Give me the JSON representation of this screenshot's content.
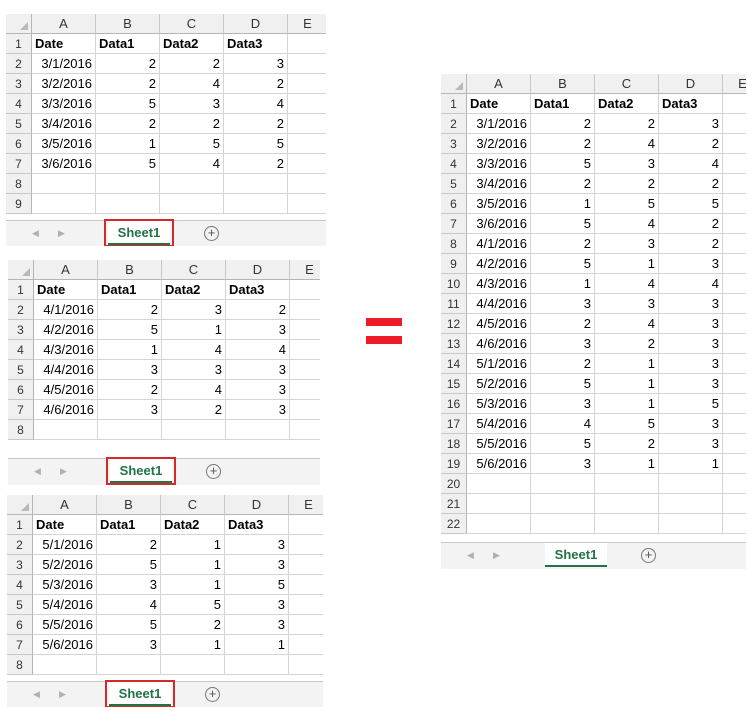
{
  "columns": [
    "A",
    "B",
    "C",
    "D",
    "E"
  ],
  "header_row": [
    "Date",
    "Data1",
    "Data2",
    "Data3"
  ],
  "tab_label": "Sheet1",
  "add_sheet_symbol": "+",
  "equals_symbol": "=",
  "colors": {
    "tab_green": "#217346",
    "highlight_red": "#d02a2a",
    "equals_red": "#ee1c25"
  },
  "icons": [
    "scroll-left-arrow-icon",
    "scroll-right-arrow-icon",
    "add-sheet-icon",
    "select-all-icon"
  ],
  "sheets": [
    {
      "name": "sheet-source-1",
      "rows": [
        [
          "3/1/2016",
          "2",
          "2",
          "3"
        ],
        [
          "3/2/2016",
          "2",
          "4",
          "2"
        ],
        [
          "3/3/2016",
          "5",
          "3",
          "4"
        ],
        [
          "3/4/2016",
          "2",
          "2",
          "2"
        ],
        [
          "3/5/2016",
          "1",
          "5",
          "5"
        ],
        [
          "3/6/2016",
          "5",
          "4",
          "2"
        ]
      ],
      "row_numbers": [
        "1",
        "2",
        "3",
        "4",
        "5",
        "6",
        "7",
        "8",
        "9"
      ]
    },
    {
      "name": "sheet-source-2",
      "rows": [
        [
          "4/1/2016",
          "2",
          "3",
          "2"
        ],
        [
          "4/2/2016",
          "5",
          "1",
          "3"
        ],
        [
          "4/3/2016",
          "1",
          "4",
          "4"
        ],
        [
          "4/4/2016",
          "3",
          "3",
          "3"
        ],
        [
          "4/5/2016",
          "2",
          "4",
          "3"
        ],
        [
          "4/6/2016",
          "3",
          "2",
          "3"
        ]
      ],
      "row_numbers": [
        "1",
        "2",
        "3",
        "4",
        "5",
        "6",
        "7",
        "8"
      ]
    },
    {
      "name": "sheet-source-3",
      "rows": [
        [
          "5/1/2016",
          "2",
          "1",
          "3"
        ],
        [
          "5/2/2016",
          "5",
          "1",
          "3"
        ],
        [
          "5/3/2016",
          "3",
          "1",
          "5"
        ],
        [
          "5/4/2016",
          "4",
          "5",
          "3"
        ],
        [
          "5/5/2016",
          "5",
          "2",
          "3"
        ],
        [
          "5/6/2016",
          "3",
          "1",
          "1"
        ]
      ],
      "row_numbers": [
        "1",
        "2",
        "3",
        "4",
        "5",
        "6",
        "7",
        "8"
      ]
    },
    {
      "name": "sheet-combined",
      "rows": [
        [
          "3/1/2016",
          "2",
          "2",
          "3"
        ],
        [
          "3/2/2016",
          "2",
          "4",
          "2"
        ],
        [
          "3/3/2016",
          "5",
          "3",
          "4"
        ],
        [
          "3/4/2016",
          "2",
          "2",
          "2"
        ],
        [
          "3/5/2016",
          "1",
          "5",
          "5"
        ],
        [
          "3/6/2016",
          "5",
          "4",
          "2"
        ],
        [
          "4/1/2016",
          "2",
          "3",
          "2"
        ],
        [
          "4/2/2016",
          "5",
          "1",
          "3"
        ],
        [
          "4/3/2016",
          "1",
          "4",
          "4"
        ],
        [
          "4/4/2016",
          "3",
          "3",
          "3"
        ],
        [
          "4/5/2016",
          "2",
          "4",
          "3"
        ],
        [
          "4/6/2016",
          "3",
          "2",
          "3"
        ],
        [
          "5/1/2016",
          "2",
          "1",
          "3"
        ],
        [
          "5/2/2016",
          "5",
          "1",
          "3"
        ],
        [
          "5/3/2016",
          "3",
          "1",
          "5"
        ],
        [
          "5/4/2016",
          "4",
          "5",
          "3"
        ],
        [
          "5/5/2016",
          "5",
          "2",
          "3"
        ],
        [
          "5/6/2016",
          "3",
          "1",
          "1"
        ]
      ],
      "row_numbers": [
        "1",
        "2",
        "3",
        "4",
        "5",
        "6",
        "7",
        "8",
        "9",
        "10",
        "11",
        "12",
        "13",
        "14",
        "15",
        "16",
        "17",
        "18",
        "19",
        "20",
        "21",
        "22"
      ]
    }
  ]
}
